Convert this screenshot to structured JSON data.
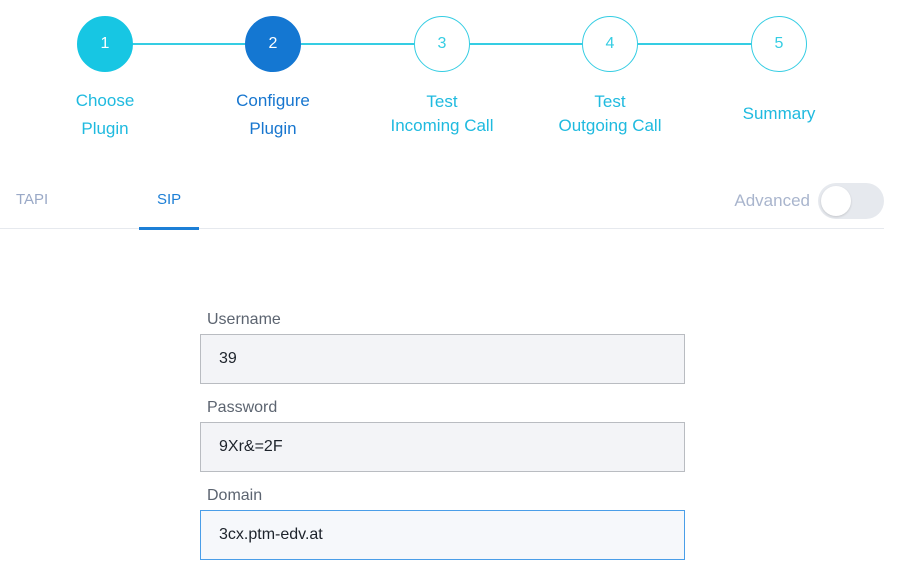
{
  "stepper": {
    "steps": [
      {
        "number": "1",
        "label_line1": "Choose",
        "label_line2": "Plugin",
        "state": "done"
      },
      {
        "number": "2",
        "label_line1": "Configure",
        "label_line2": "Plugin",
        "state": "active"
      },
      {
        "number": "3",
        "label_line1": "Test",
        "label_line2": "Incoming Call",
        "state": "pending"
      },
      {
        "number": "4",
        "label_line1": "Test",
        "label_line2": "Outgoing Call",
        "state": "pending"
      },
      {
        "number": "5",
        "label_line1": "Summary",
        "label_line2": "",
        "state": "pending"
      }
    ],
    "colors": {
      "done": "#17c6e3",
      "active": "#1477d2",
      "pending_border": "#35cde3"
    }
  },
  "tabs": {
    "items": [
      {
        "label": "TAPI",
        "active": false
      },
      {
        "label": "SIP",
        "active": true
      }
    ],
    "advanced_label": "Advanced",
    "advanced_enabled": false
  },
  "form": {
    "username": {
      "label": "Username",
      "value": "39"
    },
    "password": {
      "label": "Password",
      "value": "9Xr&=2F"
    },
    "domain": {
      "label": "Domain",
      "value": "3cx.ptm-edv.at"
    }
  }
}
